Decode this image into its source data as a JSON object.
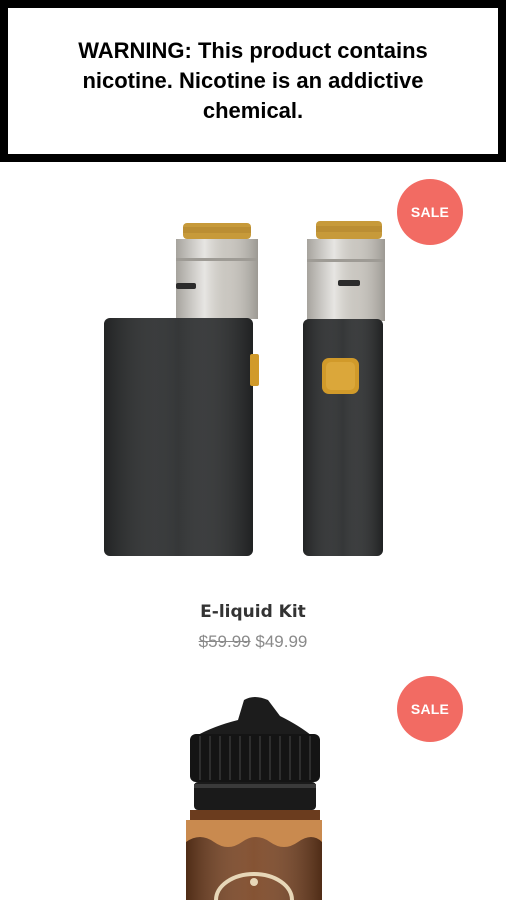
{
  "warning": {
    "text": "WARNING: This product contains nicotine. Nicotine is an addictive chemical."
  },
  "products": [
    {
      "badge": "SALE",
      "title": "E-liquid Kit",
      "price_old": "$59.99",
      "price_new": "$49.99",
      "image_icon": "vape-kit-image"
    },
    {
      "badge": "SALE",
      "image_icon": "e-liquid-bottle-image"
    }
  ],
  "colors": {
    "sale_badge": "#f26b63",
    "device_body": "#2d2f30",
    "tank_metal": "#c9c6c0",
    "tank_glass": "#c79a3a",
    "button_gold": "#d19a2a"
  }
}
